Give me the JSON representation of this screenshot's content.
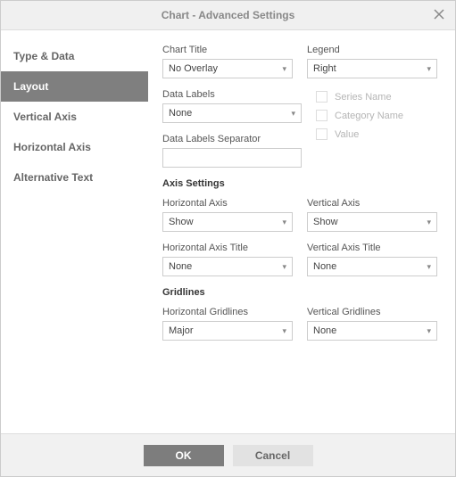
{
  "dialog": {
    "title": "Chart - Advanced Settings"
  },
  "sidebar": {
    "items": [
      {
        "label": "Type & Data",
        "active": false
      },
      {
        "label": "Layout",
        "active": true
      },
      {
        "label": "Vertical Axis",
        "active": false
      },
      {
        "label": "Horizontal Axis",
        "active": false
      },
      {
        "label": "Alternative Text",
        "active": false
      }
    ]
  },
  "layout": {
    "chartTitle": {
      "label": "Chart Title",
      "value": "No Overlay"
    },
    "legend": {
      "label": "Legend",
      "value": "Right"
    },
    "dataLabels": {
      "label": "Data Labels",
      "value": "None"
    },
    "dataLabelsSeparator": {
      "label": "Data Labels Separator",
      "value": ""
    },
    "checkboxes": {
      "seriesName": {
        "label": "Series Name",
        "checked": false,
        "disabled": true
      },
      "categoryName": {
        "label": "Category Name",
        "checked": false,
        "disabled": true
      },
      "value": {
        "label": "Value",
        "checked": false,
        "disabled": true
      }
    },
    "axisSettings": {
      "title": "Axis Settings",
      "horizontalAxis": {
        "label": "Horizontal Axis",
        "value": "Show"
      },
      "verticalAxis": {
        "label": "Vertical Axis",
        "value": "Show"
      },
      "horizontalAxisTitle": {
        "label": "Horizontal Axis Title",
        "value": "None"
      },
      "verticalAxisTitle": {
        "label": "Vertical Axis Title",
        "value": "None"
      }
    },
    "gridlines": {
      "title": "Gridlines",
      "horizontal": {
        "label": "Horizontal Gridlines",
        "value": "Major"
      },
      "vertical": {
        "label": "Vertical Gridlines",
        "value": "None"
      }
    }
  },
  "footer": {
    "ok": "OK",
    "cancel": "Cancel"
  }
}
